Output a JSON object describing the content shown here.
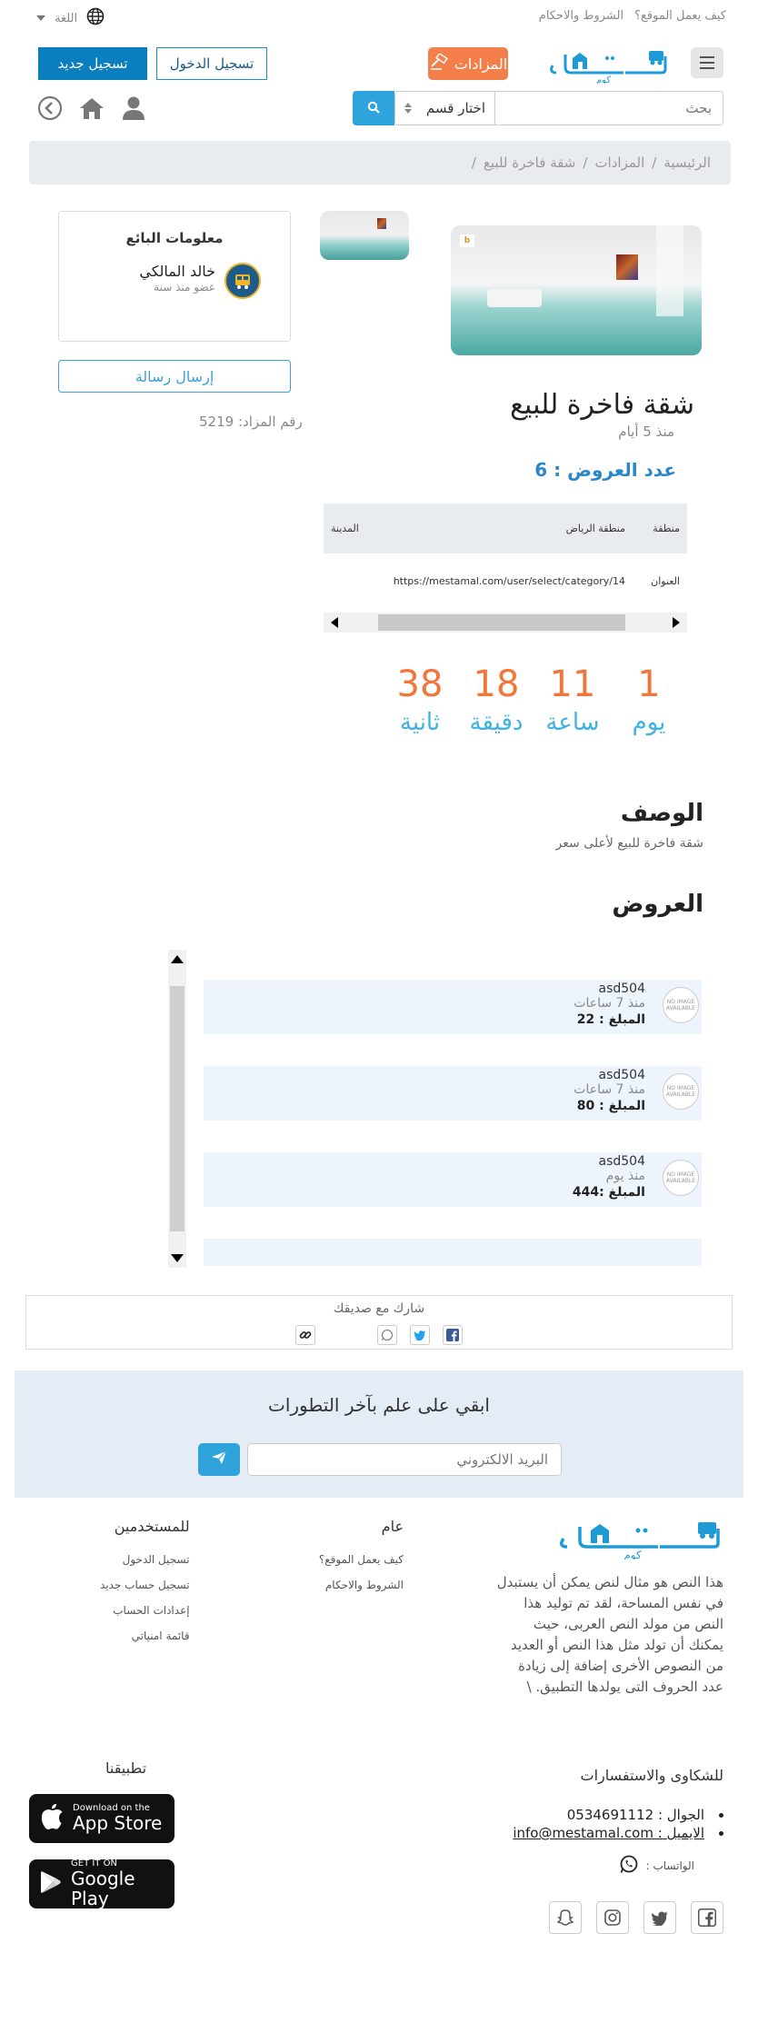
{
  "topbar": {
    "how_it_works": "كيف يعمل الموقع؟",
    "terms": "الشروط والاحكام",
    "language": "اللغة"
  },
  "header": {
    "logo_text": "مستعمل",
    "logo_sub": "كوم",
    "auctions_label": "المزادات",
    "login_label": "تسجيل الدخول",
    "register_label": "تسجيل جديد"
  },
  "search": {
    "placeholder": "بحث",
    "category_select": "اختار قسم"
  },
  "breadcrumb": {
    "home": "الرئيسية",
    "auctions": "المزادات",
    "current": "شقة فاخرة للبيع"
  },
  "seller": {
    "title": "معلومات البائع",
    "name": "خالد المالكي",
    "member_since": "عضو منذ سنة",
    "message_button": "إرسال رسالة",
    "auction_number": "رقم المزاد: 5219"
  },
  "listing": {
    "title": "شقة فاخرة للبيع",
    "posted": "منذ 5 أيام",
    "offers_count": "عدد العروض : 6",
    "info": {
      "region_label": "منطقة",
      "region_value": "منطقة الرياض",
      "city_label": "المدينة",
      "address_label": "العنوان",
      "address_value": "https://mestamal.com/user/select/category/14"
    }
  },
  "countdown": [
    {
      "value": "1",
      "label": "يوم"
    },
    {
      "value": "11",
      "label": "ساعة"
    },
    {
      "value": "18",
      "label": "دقيقة"
    },
    {
      "value": "38",
      "label": "ثانية"
    }
  ],
  "description": {
    "title": "الوصف",
    "text": "شقة فاخرة للبيع لأعلى سعر"
  },
  "offers": {
    "title": "العروض",
    "no_image": "NO IMAGE AVAILABLE",
    "items": [
      {
        "name": "asd504",
        "time": "منذ 7 ساعات",
        "amount": "المبلغ : 22"
      },
      {
        "name": "asd504",
        "time": "منذ 7 ساعات",
        "amount": "المبلغ : 80"
      },
      {
        "name": "asd504",
        "time": "منذ يوم",
        "amount": "المبلغ :444"
      }
    ]
  },
  "share": {
    "title": "شارك مع صديقك"
  },
  "newsletter": {
    "title": "ابقي على علم بآخر التطورات",
    "placeholder": "البريد الالكتروني"
  },
  "footer": {
    "about": "هذا النص هو مثال لنص يمكن أن يستبدل في نفس المساحة، لقد تم توليد هذا النص من مولد النص العربى، حيث يمكنك أن تولد مثل هذا النص أو العديد من النصوص الأخرى إضافة إلى زيادة عدد الحروف التى يولدها التطبيق. \\",
    "general": {
      "title": "عام",
      "links": [
        "كيف يعمل الموقع؟",
        "الشروط والاحكام"
      ]
    },
    "users": {
      "title": "للمستخدمين",
      "links": [
        "تسجيل الدخول",
        "تسجيل حساب جديد",
        "إعدادات الحساب",
        "قائمة امنياتي"
      ]
    },
    "complaints_title": "للشكاوى والاستفسارات",
    "phone": "الجوال : 0534691112",
    "email": "الايميل : info@mestamal.com",
    "whatsapp": "الواتساب :",
    "apps_title": "تطبيقنا",
    "app_store_small": "Download on the",
    "app_store_big": "App Store",
    "google_play_small": "GET IT ON",
    "google_play_big": "Google Play"
  },
  "colors": {
    "brand_blue": "#2fa3dc",
    "orange": "#f47f4a",
    "countdown_number": "#f2753a",
    "countdown_label": "#3fb2e3"
  }
}
